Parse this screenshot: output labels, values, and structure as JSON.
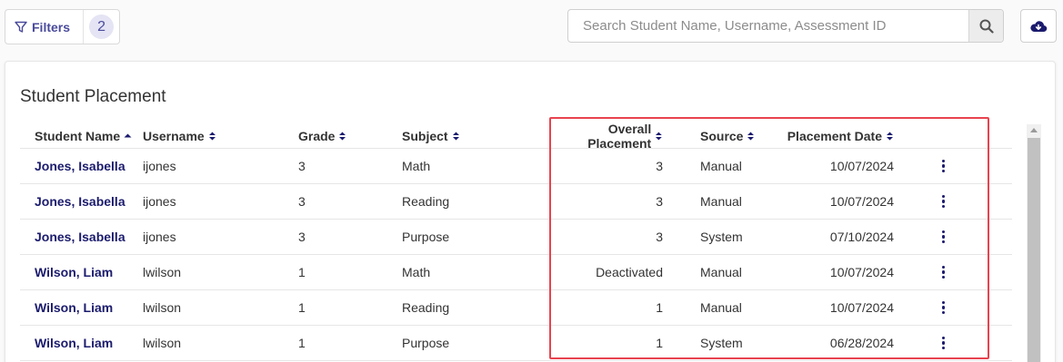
{
  "toolbar": {
    "filters_label": "Filters",
    "filters_count": "2",
    "search_placeholder": "Search Student Name, Username, Assessment ID"
  },
  "card": {
    "title": "Student Placement"
  },
  "table": {
    "columns": [
      "Student Name",
      "Username",
      "Grade",
      "Subject",
      "Overall Placement",
      "Source",
      "Placement Date"
    ],
    "rows": [
      {
        "name": "Jones, Isabella",
        "username": "ijones",
        "grade": "3",
        "subject": "Math",
        "placement": "3",
        "source": "Manual",
        "date": "10/07/2024"
      },
      {
        "name": "Jones, Isabella",
        "username": "ijones",
        "grade": "3",
        "subject": "Reading",
        "placement": "3",
        "source": "Manual",
        "date": "10/07/2024"
      },
      {
        "name": "Jones, Isabella",
        "username": "ijones",
        "grade": "3",
        "subject": "Purpose",
        "placement": "3",
        "source": "System",
        "date": "07/10/2024"
      },
      {
        "name": "Wilson, Liam",
        "username": "lwilson",
        "grade": "1",
        "subject": "Math",
        "placement": "Deactivated",
        "source": "Manual",
        "date": "10/07/2024"
      },
      {
        "name": "Wilson, Liam",
        "username": "lwilson",
        "grade": "1",
        "subject": "Reading",
        "placement": "1",
        "source": "Manual",
        "date": "10/07/2024"
      },
      {
        "name": "Wilson, Liam",
        "username": "lwilson",
        "grade": "1",
        "subject": "Purpose",
        "placement": "1",
        "source": "System",
        "date": "06/28/2024"
      }
    ]
  },
  "colors": {
    "accent": "#1b1b6e",
    "highlight": "#e8434f"
  }
}
